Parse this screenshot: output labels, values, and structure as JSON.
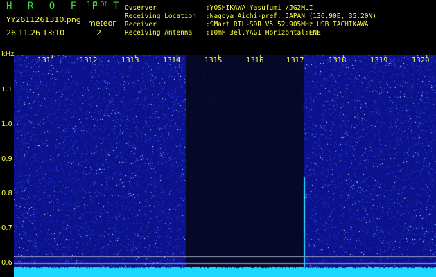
{
  "header": {
    "logo": "H R O F F T",
    "version": "1.0.0f",
    "filename": "YY2611261310.png",
    "datetime": "26.11.26 13:10",
    "meteor_label": "meteor",
    "meteor_count": "2"
  },
  "info": [
    {
      "label": "Ovserver",
      "value": ":YOSHIKAWA Yasufumi /JG2MLI"
    },
    {
      "label": "Receiving Location",
      "value": ":Nagoya Aichi-pref. JAPAN (136.90E, 35.20N)"
    },
    {
      "label": "Receiver",
      "value": ":SMart RTL-SDR V5 52.905MHz USB TACHIKAWA"
    },
    {
      "label": "Receiving Antenna",
      "value": ":10mH 3el.YAGI Horizontal:ENE"
    }
  ],
  "axis": {
    "y_unit": "kHz",
    "y_ticks": [
      {
        "label": "1.1",
        "value": 1.1
      },
      {
        "label": "1.0",
        "value": 1.0
      },
      {
        "label": "0.9",
        "value": 0.9
      },
      {
        "label": "0.8",
        "value": 0.8
      },
      {
        "label": "0.7",
        "value": 0.7
      },
      {
        "label": "0.6",
        "value": 0.6
      }
    ],
    "x_ticks": [
      "1311",
      "1312",
      "1313",
      "1314",
      "1315",
      "1316",
      "1317",
      "1318",
      "1319",
      "1320"
    ]
  },
  "colors": {
    "noise_bg": "#0b128c",
    "dark_band": "#050826",
    "trace": "#1ad8ff",
    "text": "#ffff40",
    "logo": "#3cdc3c"
  }
}
